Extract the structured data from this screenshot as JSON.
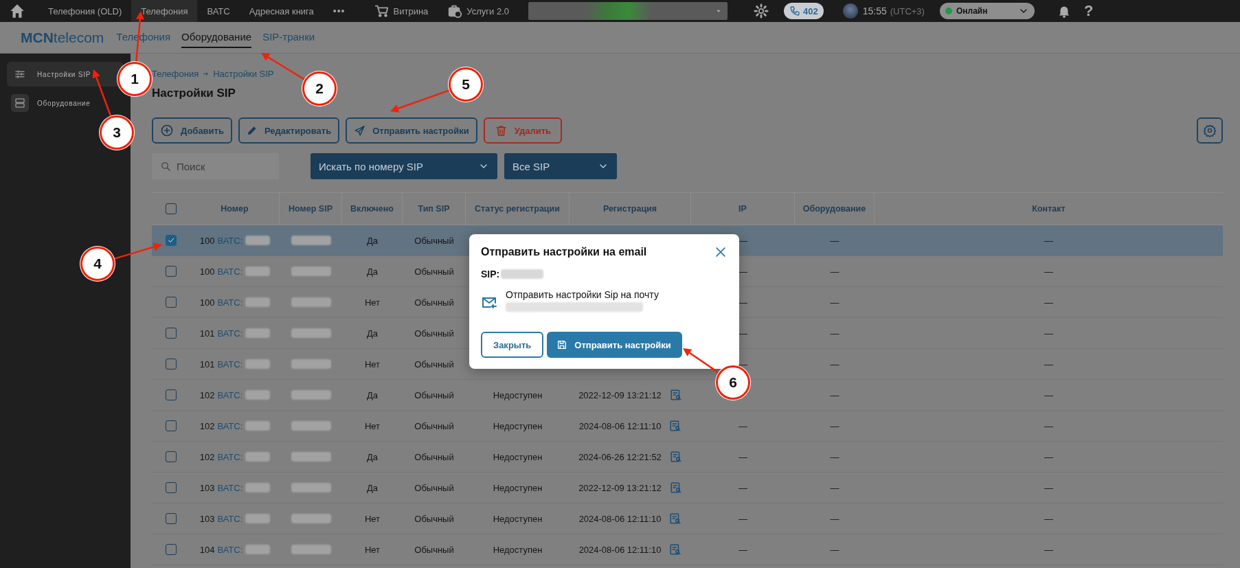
{
  "top_nav": {
    "tabs": [
      {
        "label": "Телефония (OLD)",
        "selected": false
      },
      {
        "label": "Телефония",
        "selected": true
      },
      {
        "label": "ВАТС",
        "selected": false
      },
      {
        "label": "Адресная книга",
        "selected": false
      }
    ],
    "more": "•••",
    "links": [
      {
        "label": "Витрина",
        "kind": "cart"
      },
      {
        "label": "Услуги 2.0",
        "kind": "services"
      }
    ],
    "calls_badge": "402",
    "time": "15:55",
    "timezone": "(UTC+3)",
    "status": "Онлайн",
    "help": "?"
  },
  "brand": {
    "bold": "MCN",
    "rest": "telecom"
  },
  "sub_nav": [
    {
      "label": "Телефония",
      "selected": false
    },
    {
      "label": "Оборудование",
      "selected": true
    },
    {
      "label": "SIP-транки",
      "selected": false
    }
  ],
  "sidebar": [
    {
      "label": "Настройки SIP",
      "selected": true,
      "kind": "sliders"
    },
    {
      "label": "Оборудование",
      "selected": false,
      "kind": "server"
    }
  ],
  "breadcrumb": [
    "Телефония",
    "Настройки SIP"
  ],
  "page_title": "Настройки SIP",
  "toolbar": [
    {
      "label": "Добавить",
      "kind": "add"
    },
    {
      "label": "Редактировать",
      "kind": "edit"
    },
    {
      "label": "Отправить настройки",
      "kind": "send"
    },
    {
      "label": "Удалить",
      "kind": "delete"
    }
  ],
  "filters": {
    "search_placeholder": "Поиск",
    "selects": [
      "Искать по номеру SIP",
      "Все SIP"
    ]
  },
  "table": {
    "columns": [
      "Номер",
      "Номер SIP",
      "Включено",
      "Тип SIP",
      "Статус регистрации",
      "Регистрация",
      "IP",
      "Оборудование",
      "Контакт"
    ],
    "header_checked": false,
    "rows": [
      {
        "number": "100",
        "link": "ВАТС:",
        "enabled": "Да",
        "type": "Обычный",
        "ip": "—",
        "equipment": "—",
        "contact": "—",
        "checked": true,
        "selected": true
      },
      {
        "number": "100",
        "link": "ВАТС:",
        "enabled": "Да",
        "type": "Обычный",
        "ip": "—",
        "equipment": "—",
        "contact": "—",
        "checked": false,
        "selected": false
      },
      {
        "number": "100",
        "link": "ВАТС:",
        "enabled": "Нет",
        "type": "Обычный",
        "ip": "—",
        "equipment": "—",
        "contact": "—",
        "checked": false,
        "selected": false
      },
      {
        "number": "101",
        "link": "ВАТС:",
        "enabled": "Да",
        "type": "Обычный",
        "ip": "—",
        "equipment": "—",
        "contact": "—",
        "checked": false,
        "selected": false
      },
      {
        "number": "101",
        "link": "ВАТС:",
        "enabled": "Нет",
        "type": "Обычный",
        "ip": "—",
        "equipment": "—",
        "contact": "—",
        "checked": false,
        "selected": false
      },
      {
        "number": "102",
        "link": "ВАТС:",
        "enabled": "Да",
        "type": "Обычный",
        "status": "Недоступен",
        "registration": "2022-12-09 13:21:12",
        "equipment": "—",
        "contact": "—",
        "checked": false,
        "selected": false
      },
      {
        "number": "102",
        "link": "ВАТС:",
        "enabled": "Нет",
        "type": "Обычный",
        "status": "Недоступен",
        "registration": "2024-08-06 12:11:10",
        "ip": "—",
        "equipment": "—",
        "contact": "—",
        "checked": false,
        "selected": false
      },
      {
        "number": "102",
        "link": "ВАТС:",
        "enabled": "Да",
        "type": "Обычный",
        "status": "Недоступен",
        "registration": "2024-06-26 12:21:52",
        "ip": "—",
        "equipment": "—",
        "contact": "—",
        "checked": false,
        "selected": false
      },
      {
        "number": "103",
        "link": "ВАТС:",
        "enabled": "Да",
        "type": "Обычный",
        "status": "Недоступен",
        "registration": "2022-12-09 13:21:12",
        "ip": "—",
        "equipment": "—",
        "contact": "—",
        "checked": false,
        "selected": false
      },
      {
        "number": "103",
        "link": "ВАТС:",
        "enabled": "Нет",
        "type": "Обычный",
        "status": "Недоступен",
        "registration": "2024-08-06 12:11:10",
        "ip": "—",
        "equipment": "—",
        "contact": "—",
        "checked": false,
        "selected": false
      },
      {
        "number": "104",
        "link": "ВАТС:",
        "enabled": "Нет",
        "type": "Обычный",
        "status": "Недоступен",
        "registration": "2024-08-06 12:11:10",
        "ip": "—",
        "equipment": "—",
        "contact": "—",
        "checked": false,
        "selected": false
      }
    ]
  },
  "modal": {
    "title": "Отправить настройки на email",
    "sip_label": "SIP:",
    "email_text": "Отправить настройки Sip на почту",
    "buttons": [
      {
        "label": "Закрыть",
        "kind": "secondary"
      },
      {
        "label": "Отправить настройки",
        "kind": "primary"
      }
    ]
  },
  "callouts": [
    "1",
    "2",
    "3",
    "4",
    "5",
    "6"
  ]
}
